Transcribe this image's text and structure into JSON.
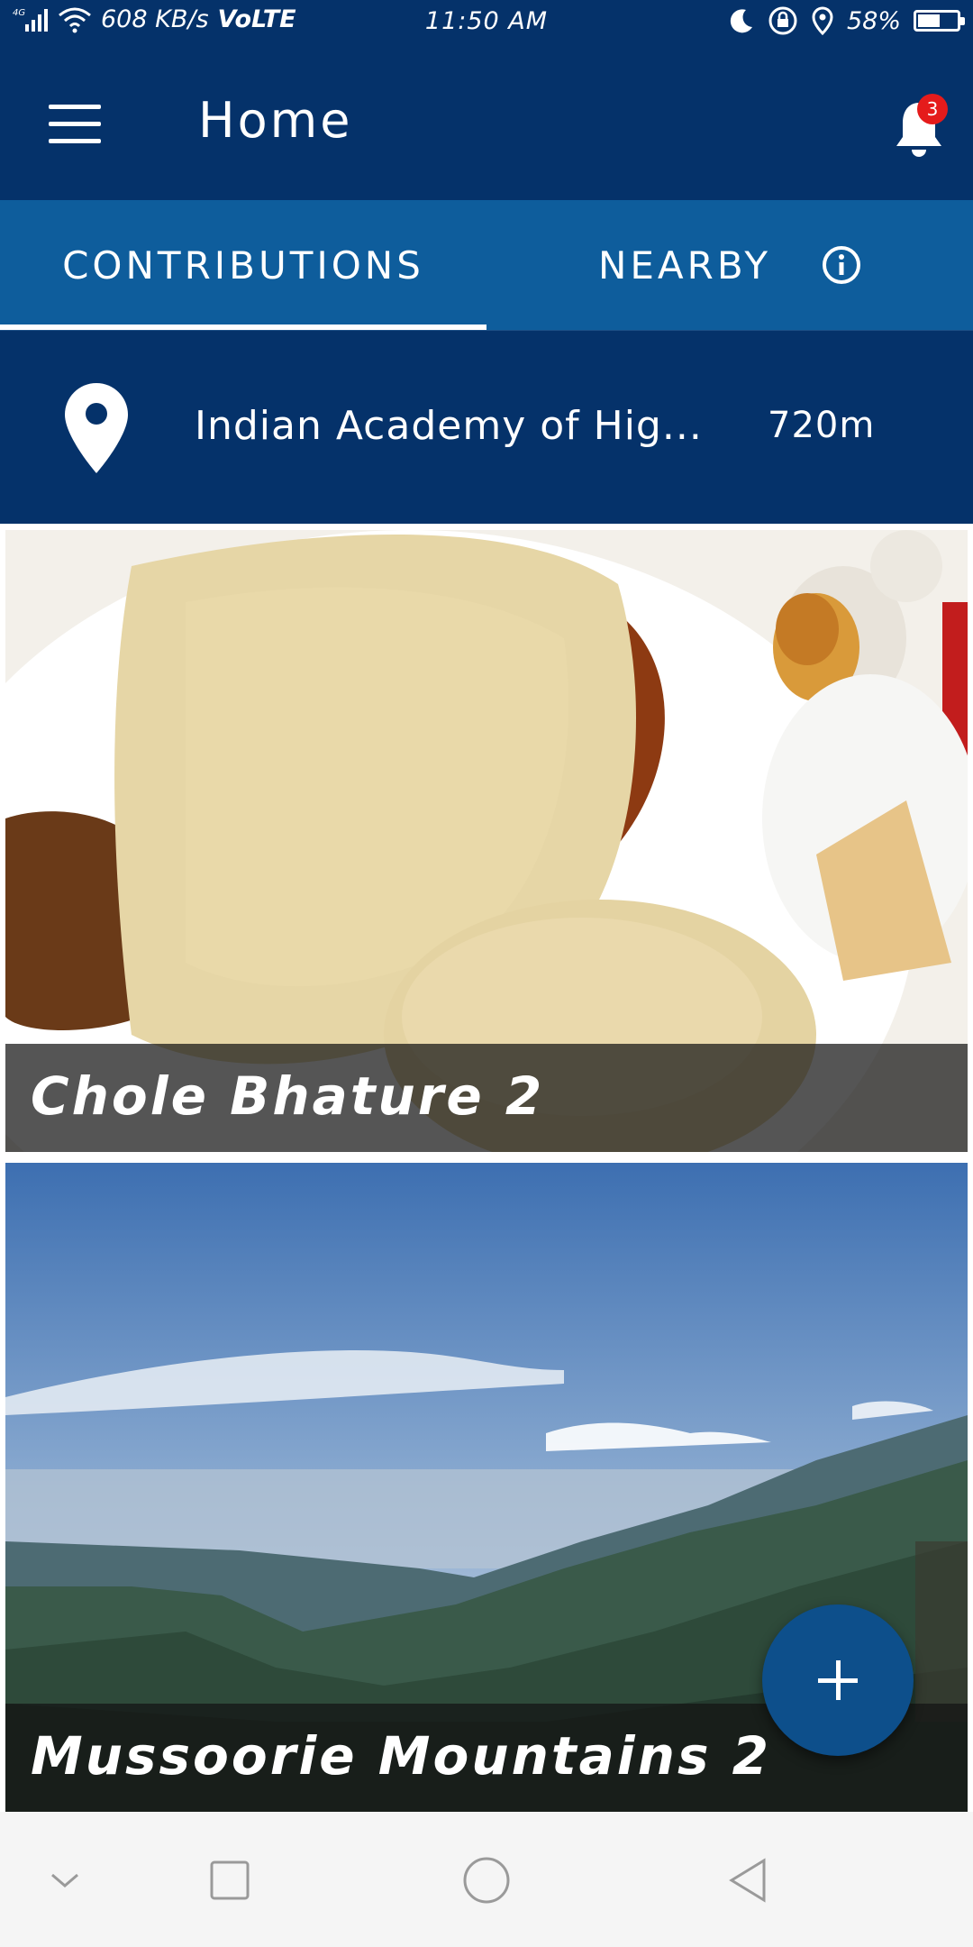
{
  "status_bar": {
    "network": "4G",
    "speed": "608 KB/s",
    "volte": "VoLTE",
    "time": "11:50 AM",
    "battery": "58%",
    "battery_level": 0.58,
    "icons": [
      "signal-icon",
      "wifi-icon",
      "moon-icon",
      "lock-rotation-icon",
      "location-icon",
      "battery-icon"
    ]
  },
  "app_bar": {
    "title": "Home",
    "notification_count": "3",
    "icons": [
      "menu-icon",
      "bell-icon"
    ]
  },
  "tabs": [
    {
      "label": "CONTRIBUTIONS",
      "selected": true
    },
    {
      "label": "NEARBY",
      "selected": false
    }
  ],
  "location": {
    "name": "Indian Academy of Hig...",
    "distance": "720m"
  },
  "cards": [
    {
      "title": "Chole Bhature 2"
    },
    {
      "title": "Mussoorie Mountains 2"
    }
  ],
  "colors": {
    "primary_dark": "#05326a",
    "tab_bar": "#0e5d9c",
    "fab": "#0d4f8b",
    "badge": "#e51b1b"
  },
  "nav_bar": {
    "icons": [
      "chevron-down-icon",
      "recents-icon",
      "home-icon",
      "back-icon"
    ]
  }
}
